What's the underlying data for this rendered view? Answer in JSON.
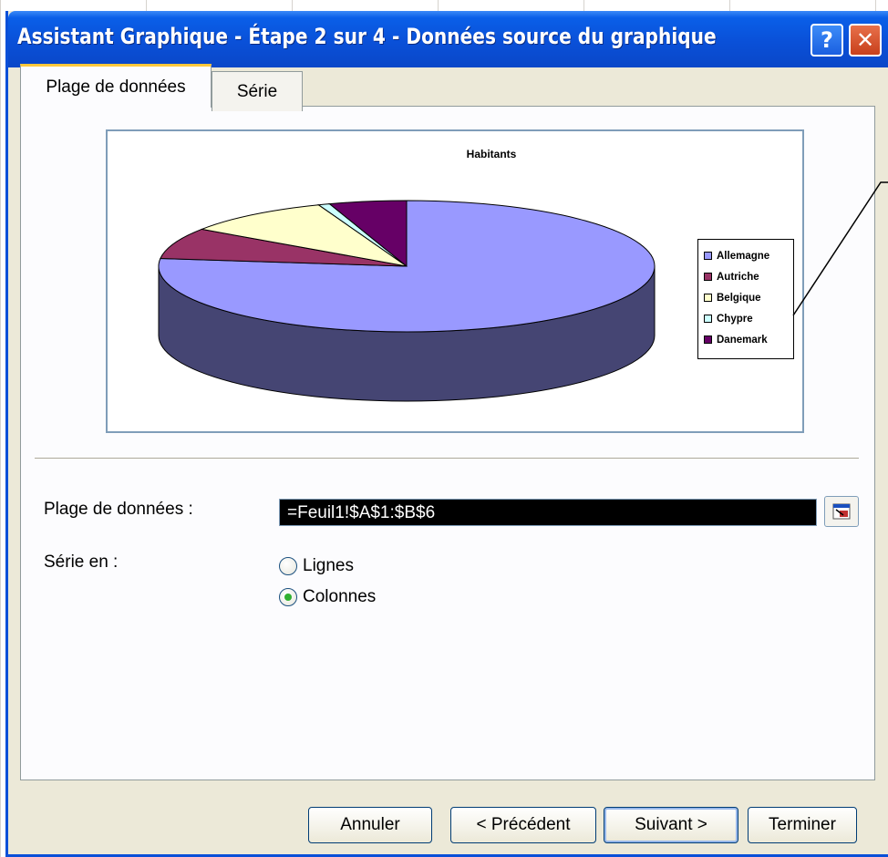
{
  "window": {
    "title": "Assistant Graphique - Étape 2 sur 4 - Données source du graphique",
    "help_glyph": "?",
    "close_glyph": "✕"
  },
  "tabs": [
    {
      "label": "Plage de données",
      "active": true
    },
    {
      "label": "Série",
      "active": false
    }
  ],
  "chart_data": {
    "type": "pie",
    "title": "Habitants",
    "categories": [
      "Allemagne",
      "Autriche",
      "Belgique",
      "Chypre",
      "Danemark"
    ],
    "values": [
      82.5,
      8.2,
      10.4,
      0.8,
      5.4
    ],
    "colors": [
      "#9999ff",
      "#993366",
      "#ffffcc",
      "#ccffff",
      "#660066"
    ],
    "legend_position": "right",
    "three_d": true
  },
  "form": {
    "range_label": "Plage de données :",
    "range_value": "=Feuil1!$A$1:$B$6",
    "series_label": "Série en :",
    "radio_lignes": "Lignes",
    "radio_colonnes": "Colonnes",
    "series_selected": "Colonnes"
  },
  "buttons": {
    "cancel": "Annuler",
    "previous": "< Précédent",
    "next": "Suivant >",
    "finish": "Terminer"
  }
}
